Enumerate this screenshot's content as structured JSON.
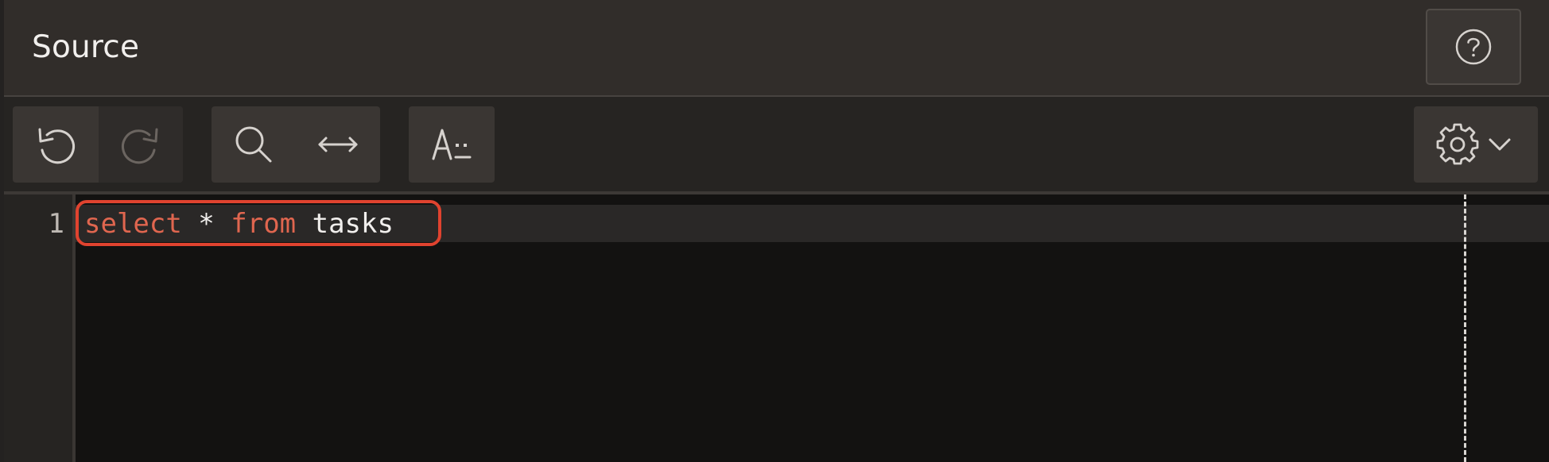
{
  "header": {
    "title": "Source",
    "help_icon": "help-icon"
  },
  "toolbar": {
    "undo_icon": "undo-icon",
    "redo_icon": "redo-icon",
    "search_icon": "search-icon",
    "replace_icon": "arrow-left-right-icon",
    "autocomplete_icon": "autocomplete-icon",
    "settings_icon": "gear-icon",
    "dropdown_icon": "chevron-down-icon"
  },
  "editor": {
    "lines": [
      {
        "number": "1",
        "tokens": [
          {
            "text": "select",
            "type": "keyword"
          },
          {
            "text": " * ",
            "type": "plain"
          },
          {
            "text": "from",
            "type": "keyword"
          },
          {
            "text": " tasks",
            "type": "plain"
          }
        ]
      }
    ]
  },
  "colors": {
    "keyword": "#e0664f",
    "highlight": "#e0432f",
    "background": "#131211"
  }
}
